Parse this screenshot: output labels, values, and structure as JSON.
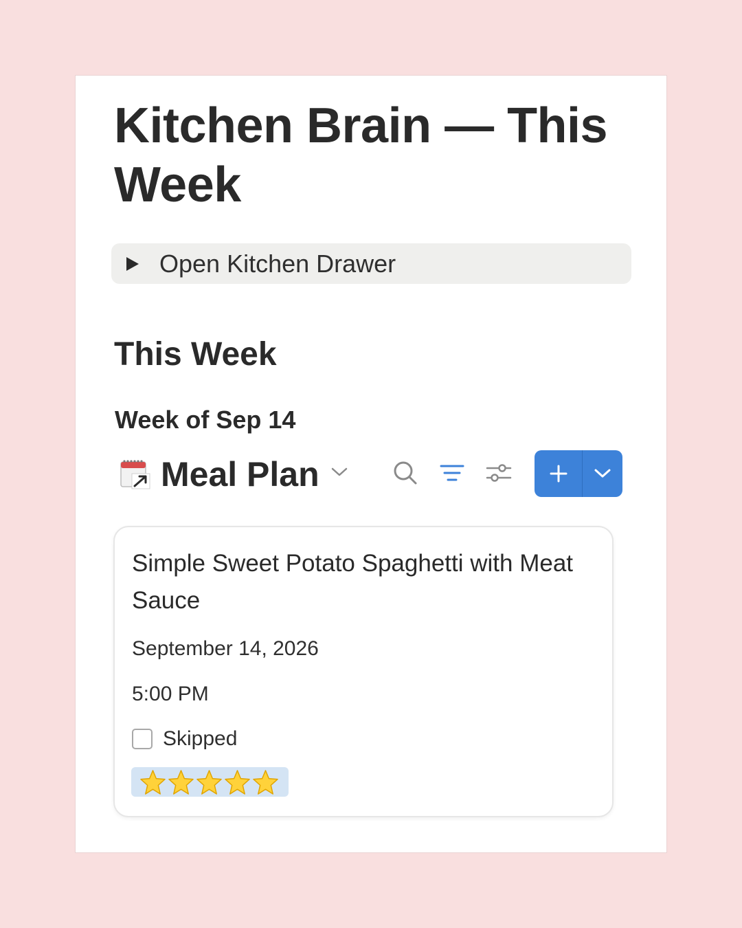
{
  "page": {
    "title": "Kitchen Brain — This Week"
  },
  "toggle": {
    "label": "Open Kitchen Drawer"
  },
  "section": {
    "heading": "This Week",
    "subheading": "Week of Sep 14"
  },
  "database": {
    "icon": "calendar-link-icon",
    "title": "Meal Plan",
    "toolbar": {
      "search_icon": "search-icon",
      "filter_icon": "filter-icon",
      "settings_icon": "sliders-icon",
      "new_icon": "plus-icon",
      "new_dropdown_icon": "chevron-down-icon"
    },
    "accent_color": "#3d82d9"
  },
  "card": {
    "title": "Simple Sweet Potato Spaghetti with Meat Sauce",
    "date": "September 14, 2026",
    "time": "5:00 PM",
    "skipped": {
      "label": "Skipped",
      "checked": false
    },
    "rating": {
      "stars": 5,
      "max": 5,
      "display": "⭐⭐⭐⭐⭐",
      "tag_color": "#d4e4f4"
    }
  },
  "colors": {
    "background": "#f9dfdf",
    "toggle_bg": "#efefed"
  }
}
